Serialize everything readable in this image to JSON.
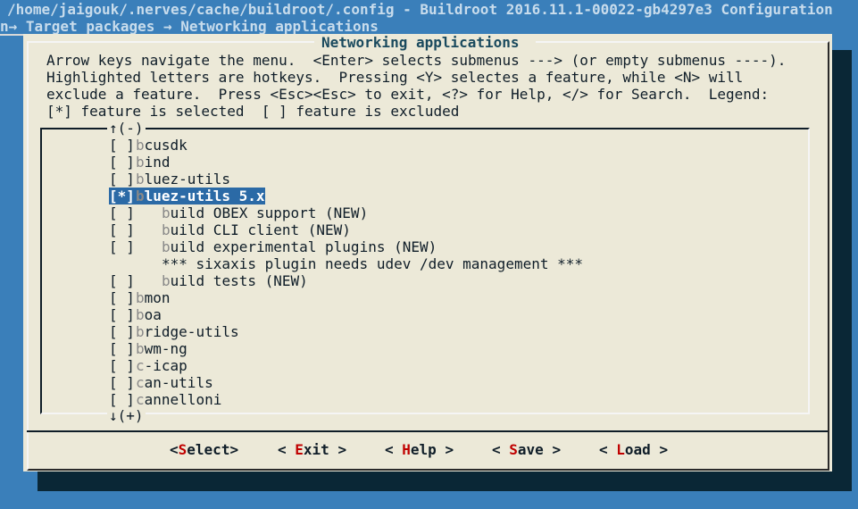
{
  "window": {
    "title": "/home/jaigouk/.nerves/cache/buildroot/.config - Buildroot 2016.11.1-00022-gb4297e3 Configuration",
    "breadcrumb": "n→ Target packages → Networking applications"
  },
  "dialog": {
    "title": "Networking applications",
    "help": [
      "Arrow keys navigate the menu.  <Enter> selects submenus ---> (or empty submenus ----).",
      "Highlighted letters are hotkeys.  Pressing <Y> selectes a feature, while <N> will",
      "exclude a feature.  Press <Esc><Esc> to exit, <?> for Help, </> for Search.  Legend:",
      "[*] feature is selected  [ ] feature is excluded"
    ],
    "scroll_up": "↑(-)",
    "scroll_down": "↓(+)",
    "items": [
      {
        "check": "[ ]",
        "hotkey": "b",
        "rest": "cusdk",
        "indent": 0,
        "selected": false
      },
      {
        "check": "[ ]",
        "hotkey": "b",
        "rest": "ind",
        "indent": 0,
        "selected": false
      },
      {
        "check": "[ ]",
        "hotkey": "b",
        "rest": "luez-utils",
        "indent": 0,
        "selected": false
      },
      {
        "check": "[*]",
        "hotkey": "b",
        "rest": "luez-utils 5.x",
        "indent": 0,
        "selected": true
      },
      {
        "check": "[ ]",
        "hotkey": "b",
        "rest": "uild OBEX support (NEW)",
        "indent": 1,
        "selected": false
      },
      {
        "check": "[ ]",
        "hotkey": "b",
        "rest": "uild CLI client (NEW)",
        "indent": 1,
        "selected": false
      },
      {
        "check": "[ ]",
        "hotkey": "b",
        "rest": "uild experimental plugins (NEW)",
        "indent": 1,
        "selected": false
      },
      {
        "check": "",
        "hotkey": "",
        "rest": "*** sixaxis plugin needs udev /dev management ***",
        "indent": 1,
        "selected": false
      },
      {
        "check": "[ ]",
        "hotkey": "b",
        "rest": "uild tests (NEW)",
        "indent": 1,
        "selected": false
      },
      {
        "check": "[ ]",
        "hotkey": "b",
        "rest": "mon",
        "indent": 0,
        "selected": false
      },
      {
        "check": "[ ]",
        "hotkey": "b",
        "rest": "oa",
        "indent": 0,
        "selected": false
      },
      {
        "check": "[ ]",
        "hotkey": "b",
        "rest": "ridge-utils",
        "indent": 0,
        "selected": false
      },
      {
        "check": "[ ]",
        "hotkey": "b",
        "rest": "wm-ng",
        "indent": 0,
        "selected": false
      },
      {
        "check": "[ ]",
        "hotkey": "c",
        "rest": "-icap",
        "indent": 0,
        "selected": false
      },
      {
        "check": "[ ]",
        "hotkey": "c",
        "rest": "an-utils",
        "indent": 0,
        "selected": false
      },
      {
        "check": "[ ]",
        "hotkey": "c",
        "rest": "annelloni",
        "indent": 0,
        "selected": false
      }
    ],
    "buttons": [
      {
        "open": "<",
        "hotkey": "S",
        "rest": "elect",
        "close": ">",
        "active": true
      },
      {
        "open": "< ",
        "hotkey": "E",
        "rest": "xit",
        "close": " >",
        "active": false
      },
      {
        "open": "< ",
        "hotkey": "H",
        "rest": "elp",
        "close": " >",
        "active": false
      },
      {
        "open": "< ",
        "hotkey": "S",
        "rest": "ave",
        "close": " >",
        "active": false
      },
      {
        "open": "< ",
        "hotkey": "L",
        "rest": "oad",
        "close": " >",
        "active": false
      }
    ]
  },
  "colors": {
    "background": "#3a7fba",
    "dialog": "#ece9d8",
    "selection": "#2b6aa6",
    "hotkey": "#c00000"
  }
}
